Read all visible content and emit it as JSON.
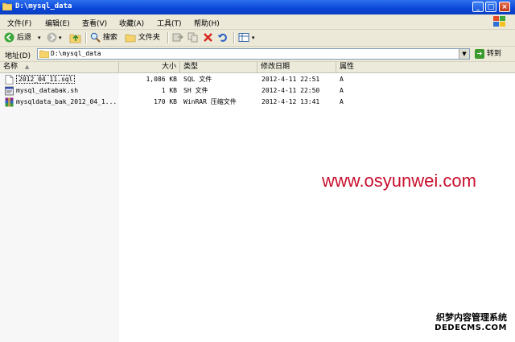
{
  "window": {
    "title": "D:\\mysql_data",
    "minimize_glyph": "_",
    "maximize_glyph": "□",
    "close_glyph": "×"
  },
  "menu": [
    "文件(F)",
    "编辑(E)",
    "查看(V)",
    "收藏(A)",
    "工具(T)",
    "帮助(H)"
  ],
  "toolbar": {
    "back_label": "后退",
    "search_label": "搜索",
    "folders_label": "文件夹"
  },
  "address": {
    "label": "地址(D)",
    "value": "D:\\mysql_data",
    "go_label": "转到"
  },
  "columns": {
    "name": "名称",
    "size": "大小",
    "type": "类型",
    "modified": "修改日期",
    "attributes": "属性"
  },
  "files": [
    {
      "name": "2012_04_11.sql",
      "size": "1,086 KB",
      "type": "SQL 文件",
      "modified": "2012-4-11 22:51",
      "attr": "A",
      "icon": "sql-file-icon"
    },
    {
      "name": "mysql_databak.sh",
      "size": "1 KB",
      "type": "SH 文件",
      "modified": "2012-4-11 22:50",
      "attr": "A",
      "icon": "sh-file-icon"
    },
    {
      "name": "mysqldata_bak_2012_04_1...",
      "size": "170 KB",
      "type": "WinRAR 压缩文件",
      "modified": "2012-4-12 13:41",
      "attr": "A",
      "icon": "winrar-archive-icon"
    }
  ],
  "overlay": {
    "watermark": "www.osyunwei.com",
    "brand_line1": "织梦内容管理系统",
    "brand_line2": "DEDECMS.COM"
  },
  "colors": {
    "title_bar": "#0a46d6",
    "watermark": "#c8102e",
    "chrome": "#ece9d8"
  }
}
